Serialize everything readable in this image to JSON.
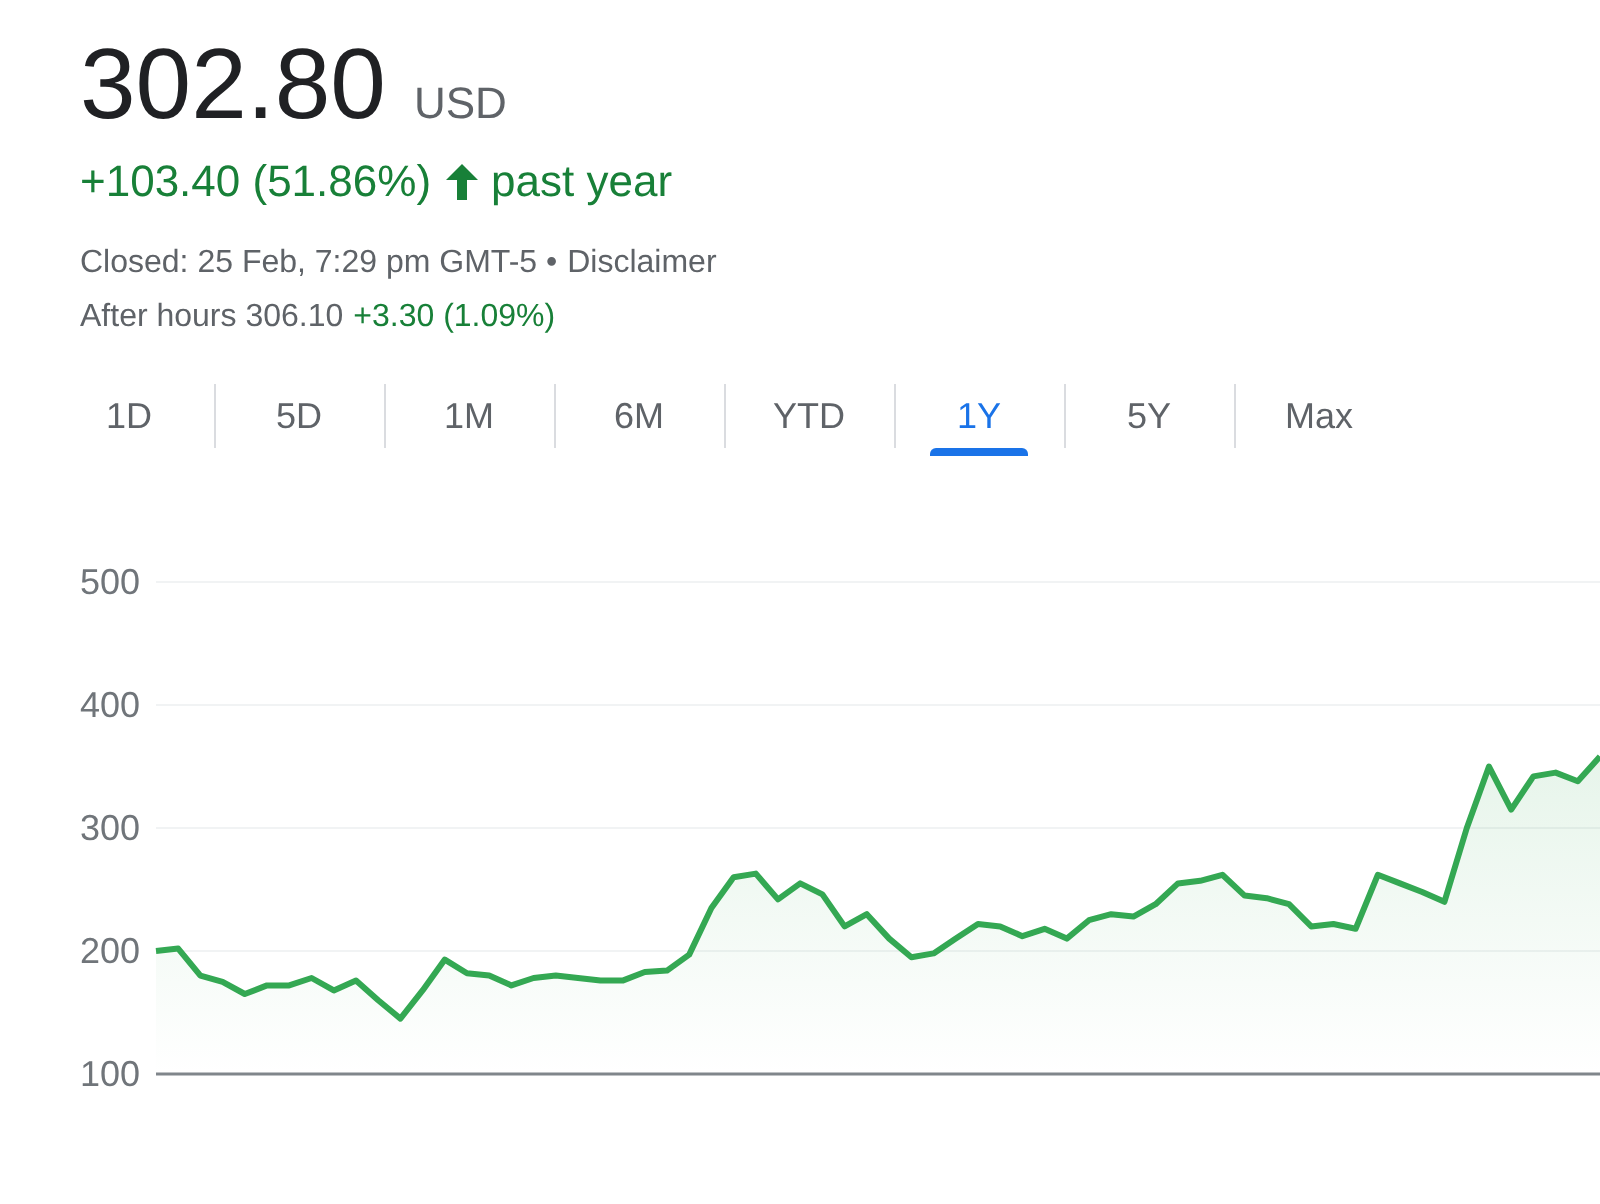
{
  "quote": {
    "price": "302.80",
    "currency": "USD",
    "change": "+103.40 (51.86%)",
    "rising": true,
    "period": "past year",
    "closed": "Closed: 25 Feb, 7:29 pm GMT-5 •",
    "disclaimer": "Disclaimer",
    "after_hours_label": "After hours 306.10",
    "after_hours_change": "+3.30 (1.09%)"
  },
  "tabs": [
    {
      "label": "1D",
      "selected": false
    },
    {
      "label": "5D",
      "selected": false
    },
    {
      "label": "1M",
      "selected": false
    },
    {
      "label": "6M",
      "selected": false
    },
    {
      "label": "YTD",
      "selected": false
    },
    {
      "label": "1Y",
      "selected": true
    },
    {
      "label": "5Y",
      "selected": false
    },
    {
      "label": "Max",
      "selected": false
    }
  ],
  "chart": {
    "chart_data": {
      "type": "area",
      "grid": true,
      "yticks": [
        100,
        200,
        300,
        400,
        500
      ],
      "ylim": [
        100,
        500
      ],
      "series": [
        {
          "color": "#34a853",
          "values": [
            200,
            202,
            180,
            175,
            165,
            172,
            172,
            178,
            168,
            176,
            160,
            145,
            168,
            193,
            182,
            180,
            172,
            178,
            180,
            178,
            176,
            176,
            183,
            184,
            197,
            235,
            260,
            263,
            242,
            255,
            246,
            220,
            230,
            210,
            195,
            198,
            210,
            222,
            220,
            212,
            218,
            210,
            225,
            230,
            228,
            238,
            255,
            257,
            262,
            245,
            243,
            238,
            220,
            222,
            218,
            262,
            255,
            248,
            240,
            300,
            350,
            315,
            342,
            345,
            338,
            358
          ]
        }
      ]
    }
  }
}
